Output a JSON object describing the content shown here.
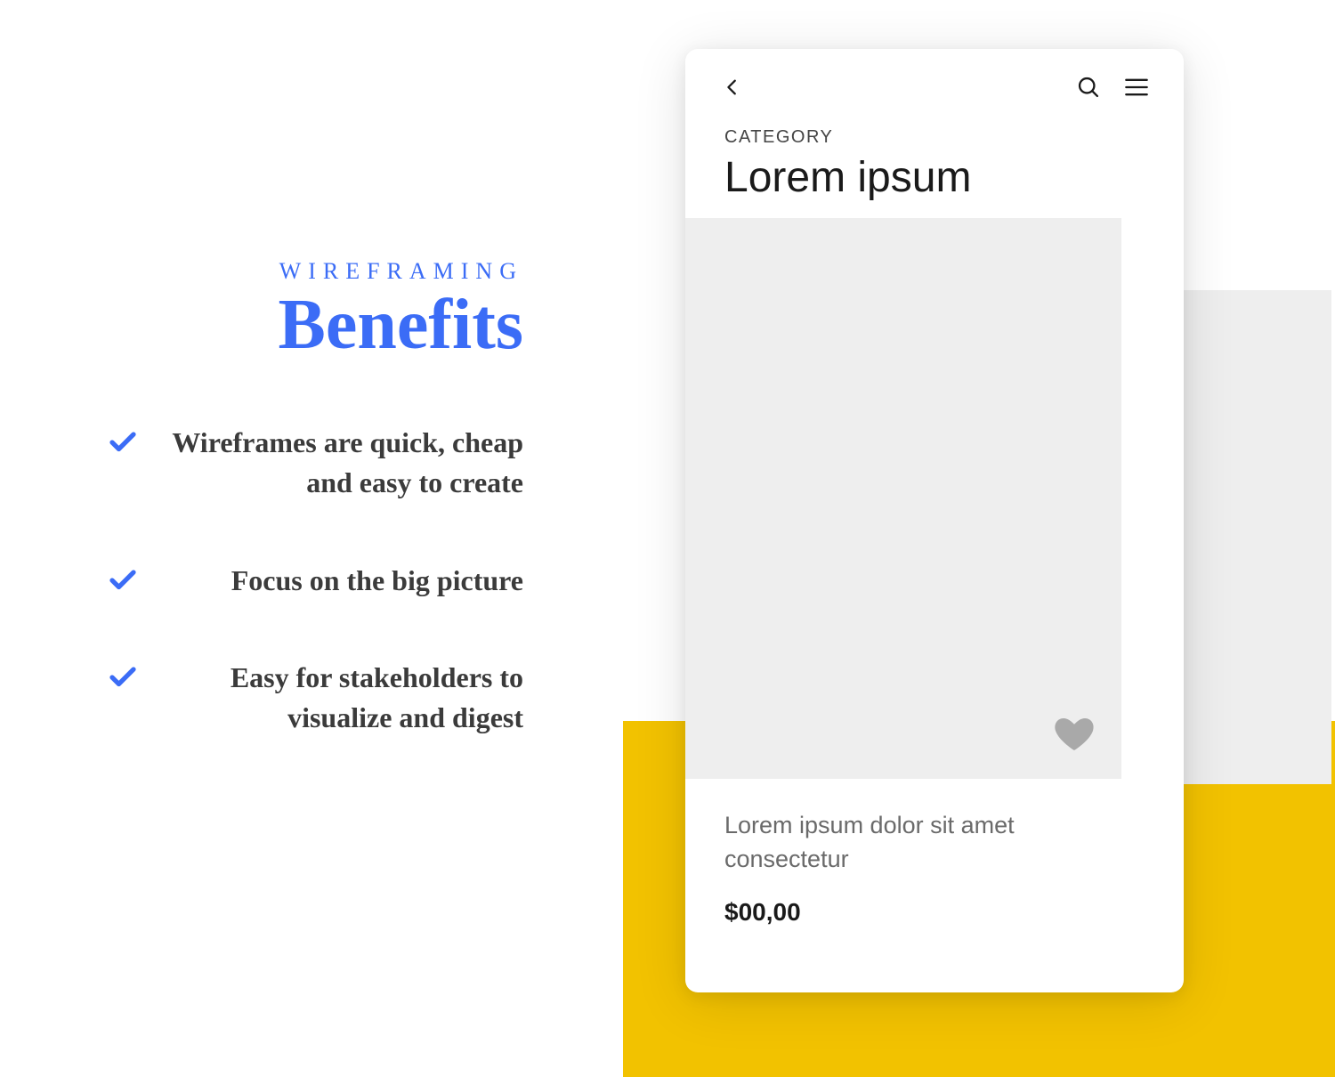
{
  "left": {
    "eyebrow": "WIREFRAMING",
    "title": "Benefits",
    "items": [
      "Wireframes are quick, cheap and easy to create",
      "Focus on the big picture",
      "Easy for stakeholders to visualize and digest"
    ]
  },
  "device": {
    "category_label": "CATEGORY",
    "title": "Lorem ipsum",
    "product_desc": "Lorem ipsum dolor sit amet consectetur",
    "price": "$00,00"
  },
  "colors": {
    "accent_blue": "#3B6CF6",
    "accent_yellow": "#F2C200",
    "placeholder_grey": "#eeeeee"
  }
}
